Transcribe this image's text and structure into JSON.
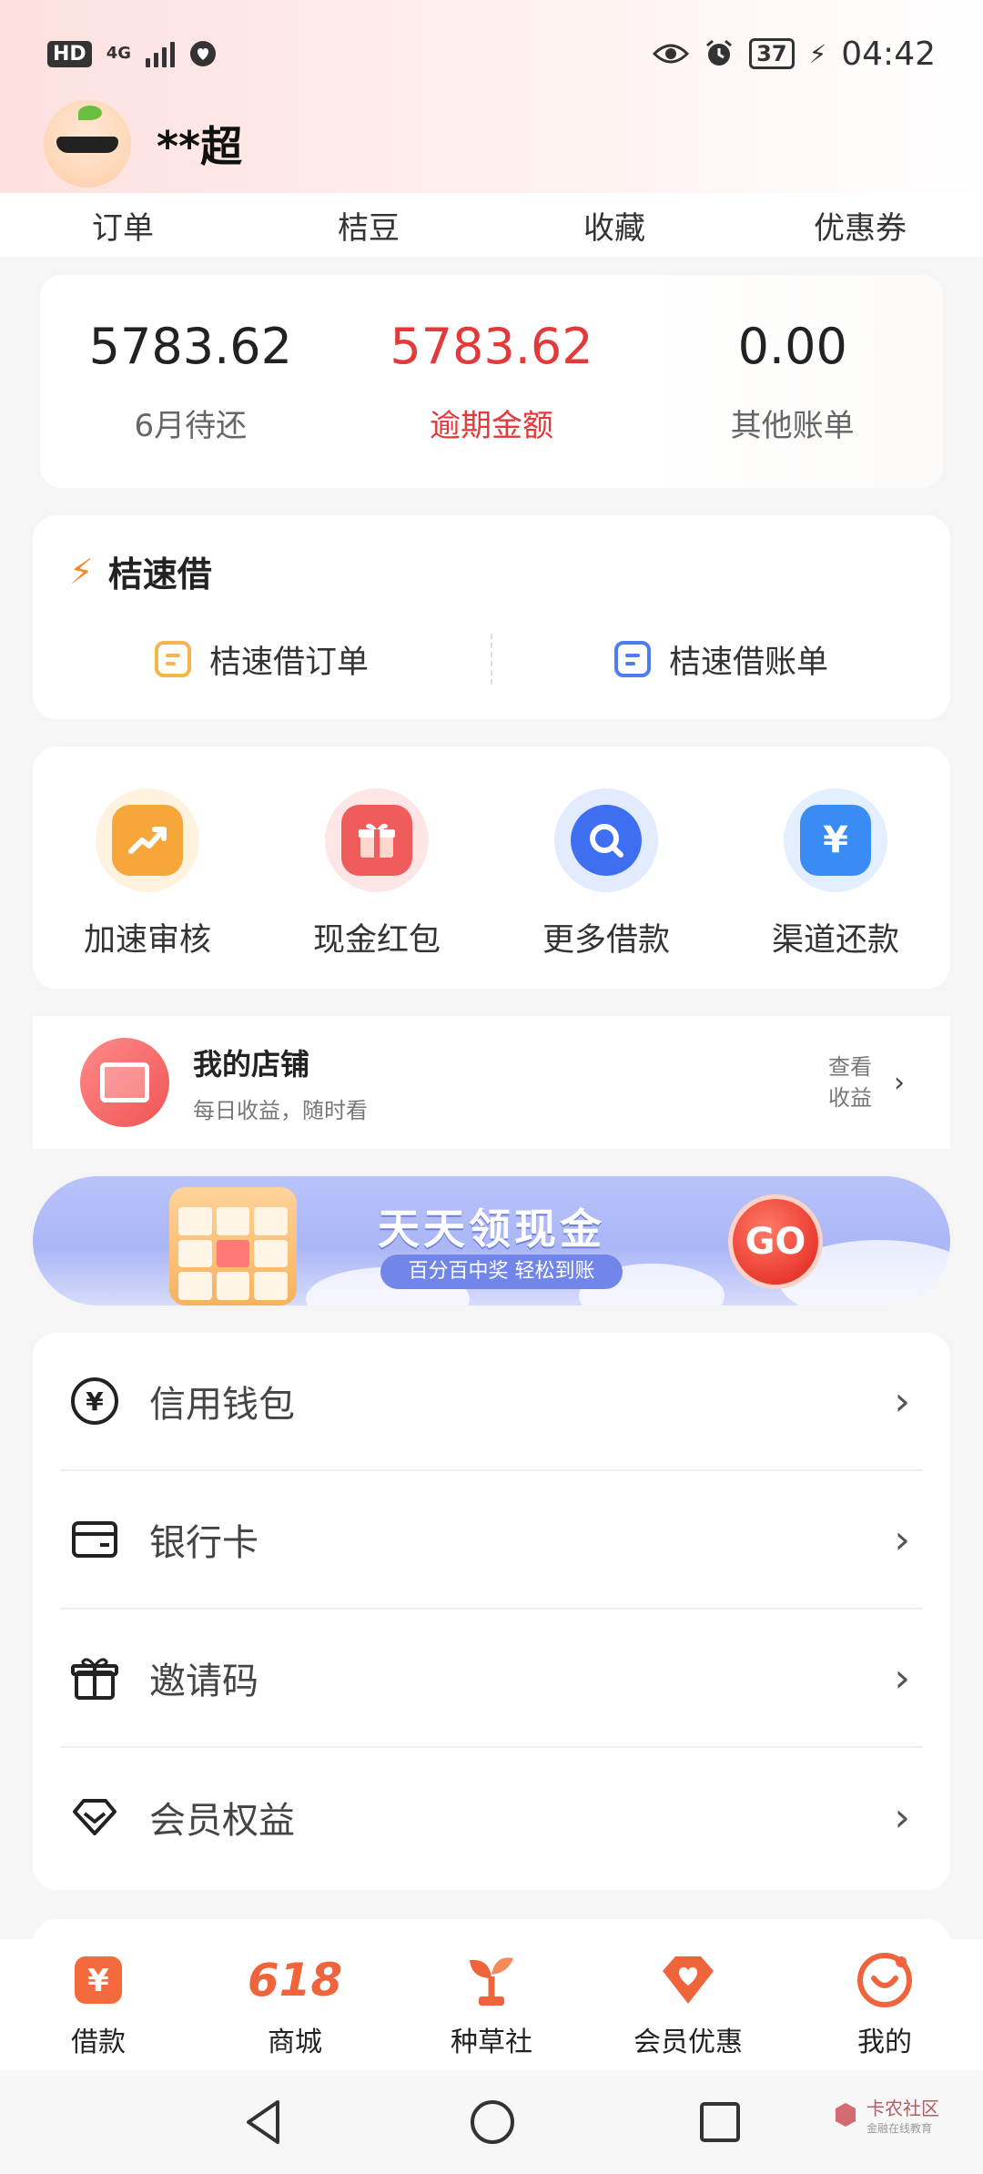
{
  "status_bar": {
    "hd": "HD",
    "network": "4G",
    "battery": "37",
    "time": "04:42"
  },
  "profile": {
    "username": "**超"
  },
  "quick_tabs": [
    "订单",
    "桔豆",
    "收藏",
    "优惠券"
  ],
  "stats": [
    {
      "value": "5783.62",
      "label": "6月待还"
    },
    {
      "value": "5783.62",
      "label": "逾期金额"
    },
    {
      "value": "0.00",
      "label": "其他账单"
    }
  ],
  "juxu": {
    "title": "桔速借",
    "order": "桔速借订单",
    "bill": "桔速借账单"
  },
  "tools": [
    {
      "label": "加速审核",
      "icon": "trend-up-icon",
      "color": "#f7a73a"
    },
    {
      "label": "现金红包",
      "icon": "gift-icon",
      "color": "#f05b5b"
    },
    {
      "label": "更多借款",
      "icon": "search-icon",
      "color": "#3d6ff0"
    },
    {
      "label": "渠道还款",
      "icon": "yen-icon",
      "color": "#3a8cf5"
    }
  ],
  "shop": {
    "title": "我的店铺",
    "subtitle": "每日收益，随时看",
    "link": "查看收益"
  },
  "banner": {
    "title": "天天领现金",
    "subtitle": "百分百中奖 轻松到账",
    "go": "GO"
  },
  "menu": [
    {
      "label": "信用钱包",
      "icon": "yen-circle-icon"
    },
    {
      "label": "银行卡",
      "icon": "card-icon"
    },
    {
      "label": "邀请码",
      "icon": "gift-outline-icon"
    },
    {
      "label": "会员权益",
      "icon": "diamond-icon"
    }
  ],
  "tab_bar": [
    {
      "label": "借款",
      "icon": "loan-icon"
    },
    {
      "label": "商城",
      "icon": "mall-618-icon",
      "icon_text": "618"
    },
    {
      "label": "种草社",
      "icon": "sprout-icon"
    },
    {
      "label": "会员优惠",
      "icon": "heart-badge-icon"
    },
    {
      "label": "我的",
      "icon": "smile-icon"
    }
  ],
  "watermark": {
    "name": "卡农社区",
    "sub": "金融在线教育"
  },
  "colors": {
    "overdue_red": "#e23a3a",
    "accent_orange": "#f28a2b",
    "accent_blue": "#4e7cf2"
  }
}
